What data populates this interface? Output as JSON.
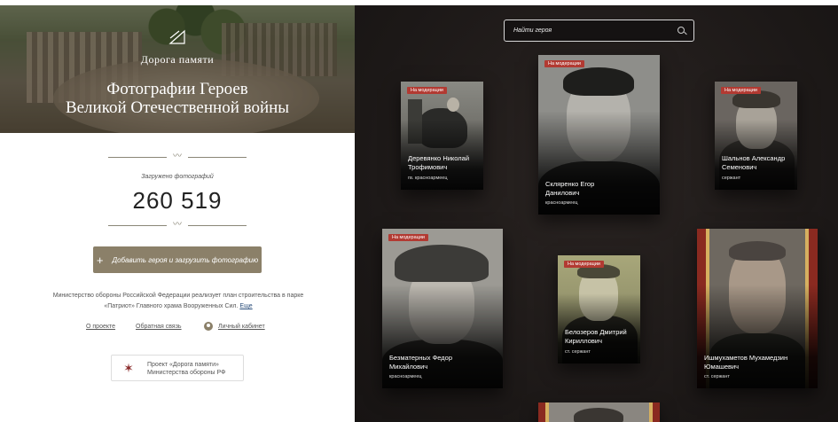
{
  "left": {
    "brand": "Дорога памяти",
    "title_line1": "Фотографии Героев",
    "title_line2": "Великой Отечественной войны",
    "uploaded_label": "Загружено фотографий",
    "counter": "260 519",
    "add_button": "Добавить героя и загрузить фотографию",
    "description": "Министерство обороны Российской Федерации реализует план строительства в парке «Патриот» Главного храма Вооруженных Сил.",
    "more_link": "Еще",
    "links": {
      "about": "О проекте",
      "feedback": "Обратная связь",
      "cabinet": "Личный кабинет"
    },
    "project_line1": "Проект «Дорога памяти»",
    "project_line2": "Министерства обороны РФ"
  },
  "search": {
    "placeholder": "Найти героя"
  },
  "cards": [
    {
      "badge": "На модерации",
      "name1": "Деревянко Николай",
      "name2": "Трофимович",
      "rank": "гв. красноармеец"
    },
    {
      "badge": "На модерации",
      "name1": "Скляренко Егор",
      "name2": "Данилович",
      "rank": "красноармеец"
    },
    {
      "badge": "На модерации",
      "name1": "Шальнов Александр",
      "name2": "Семенович",
      "rank": "сержант"
    },
    {
      "badge": "На модерации",
      "name1": "Безматерных Федор",
      "name2": "Михайлович",
      "rank": "красноармеец"
    },
    {
      "badge": "На модерации",
      "name1": "Белозеров Дмитрий",
      "name2": "Кириллович",
      "rank": "ст. сержант"
    },
    {
      "badge": "",
      "name1": "Ишмухаметов Мухамедзин",
      "name2": "Юмашевич",
      "rank": "ст. сержант"
    }
  ],
  "colors": {
    "accent": "#8b8069",
    "badge": "#b23a32",
    "dark_bg": "#1c1817"
  },
  "icons": [
    "logo-mark-icon",
    "search-icon",
    "plus-icon",
    "user-icon",
    "emblem-icon"
  ]
}
